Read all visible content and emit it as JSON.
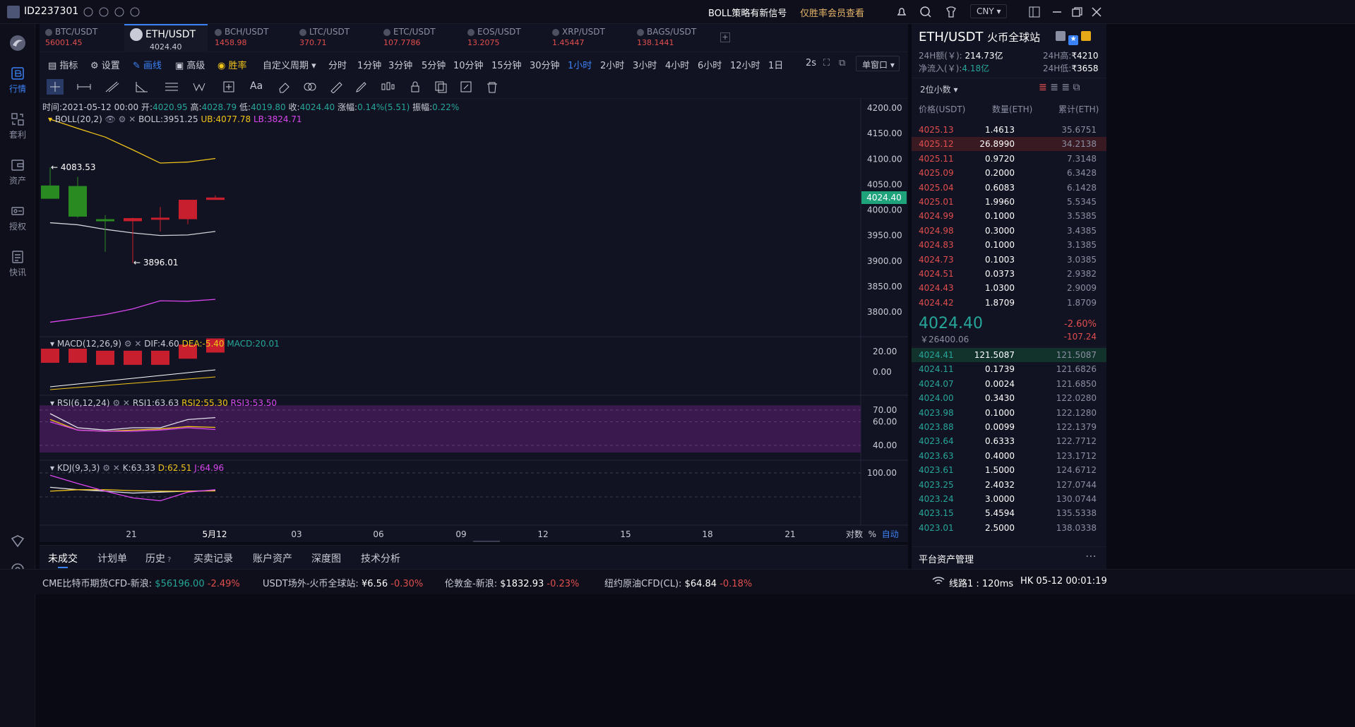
{
  "account": {
    "id": "ID2237301"
  },
  "top": {
    "signal_label": "BOLL策略有新信号",
    "signal_link": "仅胜率会员查看",
    "currency": "CNY"
  },
  "sidebar": {
    "items": [
      {
        "label": "行情",
        "icon": "market-icon"
      },
      {
        "label": "套利",
        "icon": "arbitrage-icon"
      },
      {
        "label": "资产",
        "icon": "assets-icon"
      },
      {
        "label": "授权",
        "icon": "auth-icon"
      },
      {
        "label": "快讯",
        "icon": "news-icon"
      }
    ]
  },
  "tabs": [
    {
      "name": "BTC/USDT",
      "price": "56001.45"
    },
    {
      "name": "ETH/USDT",
      "price": "4024.40"
    },
    {
      "name": "BCH/USDT",
      "price": "1458.98"
    },
    {
      "name": "LTC/USDT",
      "price": "370.71"
    },
    {
      "name": "ETC/USDT",
      "price": "107.7786"
    },
    {
      "name": "EOS/USDT",
      "price": "13.2075"
    },
    {
      "name": "XRP/USDT",
      "price": "1.45447"
    },
    {
      "name": "BAGS/USDT",
      "price": "138.1441"
    }
  ],
  "toolbar": {
    "indicator": "指标",
    "settings": "设置",
    "draw": "画线",
    "advanced": "高级",
    "winrate": "胜率",
    "custom_period": "自定义周期",
    "periods": [
      "分时",
      "1分钟",
      "3分钟",
      "5分钟",
      "10分钟",
      "15分钟",
      "30分钟",
      "1小时",
      "2小时",
      "3小时",
      "4小时",
      "6小时",
      "12小时",
      "1日"
    ],
    "selected_period": "1小时",
    "refresh": "2s",
    "window": "单窗口"
  },
  "ohlc": {
    "time_label": "时间:",
    "time": "2021-05-12 00:00",
    "open_label": "开:",
    "open": "4020.95",
    "high_label": "高:",
    "high": "4028.79",
    "low_label": "低:",
    "low": "4019.80",
    "close_label": "收:",
    "close": "4024.40",
    "change_label": "涨幅:",
    "change": "0.14%(5.51)",
    "amp_label": "振幅:",
    "amp": "0.22%"
  },
  "boll": {
    "name": "BOLL(20,2)",
    "mid": "BOLL:3951.25",
    "ub": "UB:4077.78",
    "lb": "LB:3824.71",
    "high_mark": "← 4083.53",
    "low_mark": "← 3896.01"
  },
  "macd": {
    "name": "MACD(12,26,9)",
    "dif": "DIF:4.60",
    "dea": "DEA:-5.40",
    "macd": "MACD:20.01"
  },
  "rsi": {
    "name": "RSI(6,12,24)",
    "r1": "RSI1:63.63",
    "r2": "RSI2:55.30",
    "r3": "RSI3:53.50"
  },
  "kdj": {
    "name": "KDJ(9,3,3)",
    "k": "K:63.33",
    "d": "D:62.51",
    "j": "J:64.96"
  },
  "axes": {
    "price_ticks": [
      "4200.00",
      "4150.00",
      "4100.00",
      "4050.00",
      "4000.00",
      "3950.00",
      "3900.00",
      "3850.00",
      "3800.00"
    ],
    "current_price": "4024.40",
    "macd_ticks": [
      "20.00",
      "0.00"
    ],
    "rsi_ticks": [
      "70.00",
      "60.00",
      "40.00"
    ],
    "kdj_ticks": [
      "100.00"
    ],
    "x_ticks": [
      "21",
      "5月12",
      "03",
      "06",
      "09",
      "12",
      "15",
      "18",
      "21"
    ],
    "scale_opts": [
      "对数",
      "%",
      "自动"
    ]
  },
  "chart_data": {
    "type": "candlestick",
    "candles": [
      {
        "o": 4048,
        "h": 4083.53,
        "l": 4022,
        "c": 4022
      },
      {
        "o": 4047,
        "h": 4065,
        "l": 3985,
        "c": 3987
      },
      {
        "o": 3982,
        "h": 3990,
        "l": 3918,
        "c": 3978
      },
      {
        "o": 3978,
        "h": 3985,
        "l": 3896.01,
        "c": 3984
      },
      {
        "o": 3981,
        "h": 4006,
        "l": 3958,
        "c": 3985
      },
      {
        "o": 3982,
        "h": 4015,
        "l": 3972,
        "c": 4020
      },
      {
        "o": 4019.8,
        "h": 4028.79,
        "l": 4019.8,
        "c": 4024.4
      }
    ],
    "ub": [
      4178,
      4160,
      4143,
      4118,
      4092,
      4094,
      4101
    ],
    "mid": [
      3975,
      3971,
      3962,
      3955,
      3950,
      3951,
      3958
    ],
    "lb": [
      3780,
      3787,
      3795,
      3806,
      3822,
      3821,
      3824.71
    ],
    "macd_bars": [
      20,
      20,
      18,
      18,
      18,
      24,
      30
    ],
    "rsi": {
      "r1": [
        67,
        55,
        53,
        55,
        55,
        62,
        63.63
      ],
      "r2": [
        62,
        53,
        52,
        53,
        54,
        56,
        55.3
      ],
      "r3": [
        60,
        53,
        52,
        52,
        53,
        55,
        53.5
      ]
    },
    "kdj": {
      "k": [
        70,
        65,
        62,
        58,
        60,
        62,
        63.33
      ],
      "d": [
        62,
        65,
        65,
        63,
        62,
        62,
        62.51
      ],
      "j": [
        95,
        78,
        62,
        48,
        42,
        60,
        64.96
      ]
    }
  },
  "orderbook": {
    "pair": "ETH/USDT",
    "exchange": "火币全球站",
    "vol_label": "24H额(￥):",
    "vol": "214.73亿",
    "high_label": "24H高:",
    "high": "₹4210",
    "flow_label": "净流入(￥):",
    "flow": "4.18亿",
    "low_label": "24H低:",
    "low": "₹3658",
    "decimals": "2位小数",
    "col_price": "价格(USDT)",
    "col_qty": "数量(ETH)",
    "col_total": "累计(ETH)",
    "asks": [
      [
        "4025.13",
        "1.4613",
        "35.6751"
      ],
      [
        "4025.12",
        "26.8990",
        "34.2138"
      ],
      [
        "4025.11",
        "0.9720",
        "7.3148"
      ],
      [
        "4025.09",
        "0.2000",
        "6.3428"
      ],
      [
        "4025.04",
        "0.6083",
        "6.1428"
      ],
      [
        "4025.01",
        "1.9960",
        "5.5345"
      ],
      [
        "4024.99",
        "0.1000",
        "3.5385"
      ],
      [
        "4024.98",
        "0.3000",
        "3.4385"
      ],
      [
        "4024.83",
        "0.1000",
        "3.1385"
      ],
      [
        "4024.73",
        "0.1003",
        "3.0385"
      ],
      [
        "4024.51",
        "0.0373",
        "2.9382"
      ],
      [
        "4024.43",
        "1.0300",
        "2.9009"
      ],
      [
        "4024.42",
        "1.8709",
        "1.8709"
      ]
    ],
    "last": "4024.40",
    "last_cny": "￥26400.06",
    "chg_pct": "-2.60%",
    "chg": "-107.24",
    "bids": [
      [
        "4024.41",
        "121.5087",
        "121.5087"
      ],
      [
        "4024.11",
        "0.1739",
        "121.6826"
      ],
      [
        "4024.07",
        "0.0024",
        "121.6850"
      ],
      [
        "4024.00",
        "0.3430",
        "122.0280"
      ],
      [
        "4023.98",
        "0.1000",
        "122.1280"
      ],
      [
        "4023.88",
        "0.0099",
        "122.1379"
      ],
      [
        "4023.64",
        "0.6333",
        "122.7712"
      ],
      [
        "4023.63",
        "0.4000",
        "123.1712"
      ],
      [
        "4023.61",
        "1.5000",
        "124.6712"
      ],
      [
        "4023.25",
        "2.4032",
        "127.0744"
      ],
      [
        "4023.24",
        "3.0000",
        "130.0744"
      ],
      [
        "4023.15",
        "5.4594",
        "135.5338"
      ],
      [
        "4023.01",
        "2.5000",
        "138.0338"
      ]
    ],
    "footer": "平台资产管理"
  },
  "bottom_tabs": [
    "未成交",
    "计划单",
    "历史",
    "买卖记录",
    "账户资产",
    "深度图",
    "技术分析"
  ],
  "ticker": [
    {
      "label": "CME比特币期货CFD-新浪:",
      "price": "$56196.00",
      "chg": "-2.49%"
    },
    {
      "label": "USDT场外-火币全球站:",
      "price": "¥6.56",
      "chg": "-0.30%"
    },
    {
      "label": "伦敦金-新浪:",
      "price": "$1832.93",
      "chg": "-0.23%"
    },
    {
      "label": "纽约原油CFD(CL):",
      "price": "$64.84",
      "chg": "-0.18%"
    }
  ],
  "status": {
    "line": "线路1 : 120ms",
    "time": "HK 05-12 00:01:19"
  },
  "colors": {
    "up": "#26a69a",
    "down": "#e04e4e",
    "accent": "#3b82f6",
    "boll_ub": "#f0c419",
    "boll_lb": "#d946ef",
    "rsi_band": "#3a1a4e"
  }
}
